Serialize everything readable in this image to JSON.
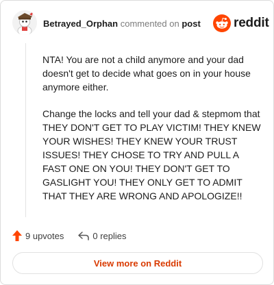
{
  "comment": {
    "username": "Betrayed_Orphan",
    "action_text": "commented on",
    "post_link_label": "post",
    "body": [
      "NTA! You are not a child anymore and your dad doesn't get to decide what goes on in your house anymore either.",
      "Change the locks and tell your dad & stepmom that THEY DON'T GET TO PLAY VICTIM! THEY KNEW YOUR WISHES! THEY KNEW YOUR TRUST ISSUES! THEY CHOSE TO TRY AND PULL A FAST ONE ON YOU! THEY DON'T GET TO GASLIGHT YOU! THEY ONLY GET TO ADMIT THAT THEY ARE WRONG AND APOLOGIZE!!"
    ]
  },
  "brand": {
    "name": "reddit",
    "icon": "reddit-logo-icon",
    "color": "#ff4500"
  },
  "footer": {
    "upvotes_label": "9 upvotes",
    "upvote_icon": "upvote-arrow-icon",
    "replies_label": "0 replies",
    "reply_icon": "reply-arrow-icon"
  },
  "view_more_label": "View more on Reddit",
  "colors": {
    "accent": "#d93a00",
    "upvote": "#ff4500"
  }
}
